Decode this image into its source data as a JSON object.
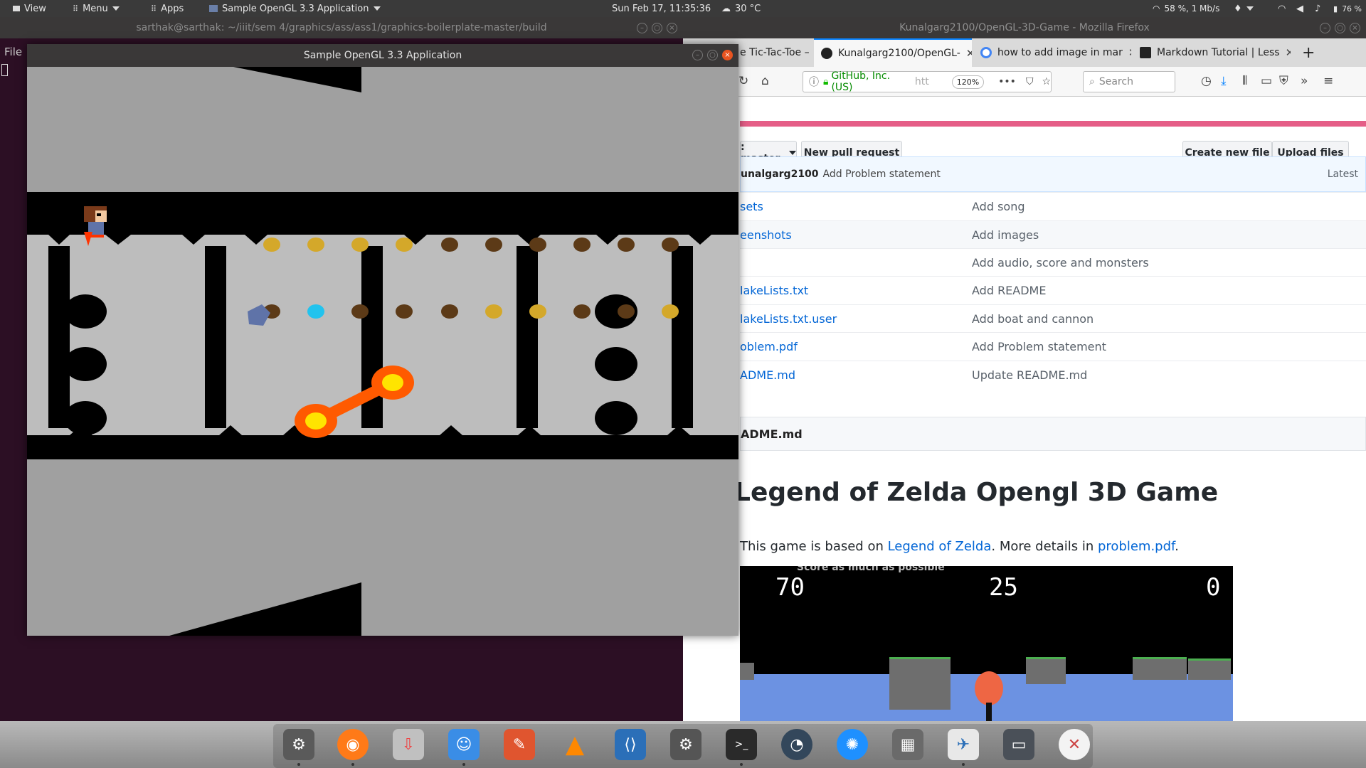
{
  "top_panel": {
    "view_label": "View",
    "menu_label": "Menu",
    "apps_label": "Apps",
    "active_window": "Sample OpenGL 3.3 Application",
    "clock": "Sun Feb 17, 11:35:36",
    "weather": "30 °C",
    "network": "58 %, 1 Mb/s",
    "battery": "76 %"
  },
  "terminal": {
    "title": "sarthak@sarthak: ~/iiit/sem 4/graphics/ass/ass1/graphics-boilerplate-master/build",
    "file_menu": "File"
  },
  "gl_window": {
    "title": "Sample OpenGL 3.3 Application"
  },
  "firefox": {
    "title": "Kunalgarg2100/OpenGL-3D-Game - Mozilla Firefox",
    "tabs": [
      {
        "label": "e Tic-Tac-Toe – M",
        "active": false
      },
      {
        "label": "Kunalgarg2100/OpenGL-",
        "active": true
      },
      {
        "label": "how to add image in mar",
        "active": false
      },
      {
        "label": "Markdown Tutorial | Less",
        "active": false
      }
    ],
    "url_identity": "GitHub, Inc. (US)",
    "url_text": "htt",
    "zoom": "120%",
    "search_placeholder": "Search"
  },
  "github": {
    "branch": ": master",
    "new_pull_request": "New pull request",
    "create_new_file": "Create new file",
    "upload_files": "Upload files",
    "commit_author": "unalgarg2100",
    "commit_message": "Add Problem statement",
    "commit_latest": "Latest",
    "files": [
      {
        "name": "sets",
        "message": "Add song"
      },
      {
        "name": "eenshots",
        "message": "Add images"
      },
      {
        "name": "",
        "message": "Add audio, score and monsters"
      },
      {
        "name": "lakeLists.txt",
        "message": "Add README"
      },
      {
        "name": "lakeLists.txt.user",
        "message": "Add boat and cannon"
      },
      {
        "name": "oblem.pdf",
        "message": "Add Problem statement"
      },
      {
        "name": "ADME.md",
        "message": "Update README.md"
      }
    ],
    "readme_header": "ADME.md",
    "readme_title": "Legend of Zelda Opengl 3D Game",
    "readme_para_prefix": "This game is based on ",
    "readme_link1": "Legend of Zelda",
    "readme_para_mid": ". More details in ",
    "readme_link2": "problem.pdf",
    "readme_para_suffix": ".",
    "readme_image_caption": "Score as much as possible",
    "readme_scores": [
      "70",
      "25",
      "0"
    ]
  },
  "colors": {
    "panel": "#3a3a3a",
    "terminal_bg": "#2c0f24",
    "gl_grey": "#a0a0a0",
    "gl_light": "#bdbdbd",
    "coin_gold": "#d4a82a",
    "coin_brown": "#5c3a17",
    "fire_orange": "#ff5a00",
    "fire_yellow": "#ffe400",
    "gh_link": "#0366d6",
    "gh_pink": "#e55e87"
  },
  "dock": {
    "icons": [
      "settings-icon",
      "firefox-icon",
      "download-icon",
      "finder-icon",
      "gimp-icon",
      "vlc-icon",
      "vscode-icon",
      "system-settings-icon",
      "terminal-icon",
      "stacer-icon",
      "gear-app-icon",
      "archive-icon",
      "mail-icon",
      "window-icon",
      "x-icon"
    ]
  }
}
